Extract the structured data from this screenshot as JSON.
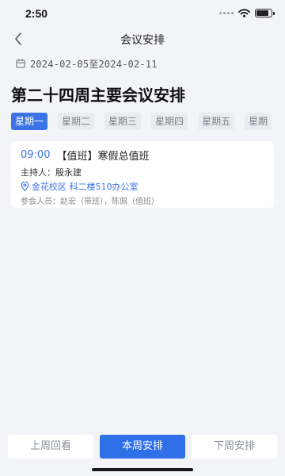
{
  "status_bar": {
    "time": "2:50",
    "battery_level": 0.85
  },
  "nav": {
    "title": "会议安排",
    "back_icon": "chevron-left-icon"
  },
  "date_range": {
    "icon": "calendar-icon",
    "text": "2024-02-05至2024-02-11"
  },
  "page_title": "第二十四周主要会议安排",
  "day_tabs": [
    {
      "label": "星期一",
      "active": true
    },
    {
      "label": "星期二",
      "active": false
    },
    {
      "label": "星期三",
      "active": false
    },
    {
      "label": "星期四",
      "active": false
    },
    {
      "label": "星期五",
      "active": false
    },
    {
      "label": "星期",
      "active": false
    }
  ],
  "meetings": [
    {
      "time": "09:00",
      "title": "【值班】寒假总值班",
      "host": "主持人：殷永建",
      "location": "金花校区 科二楼510办公室",
      "attendees": "参会人员：赵宏（带班），陈佩（值班）"
    }
  ],
  "bottom_buttons": {
    "prev": "上周回看",
    "current": "本周安排",
    "next": "下周安排"
  },
  "colors": {
    "accent": "#3b72e6",
    "background": "#f3f4f8"
  }
}
